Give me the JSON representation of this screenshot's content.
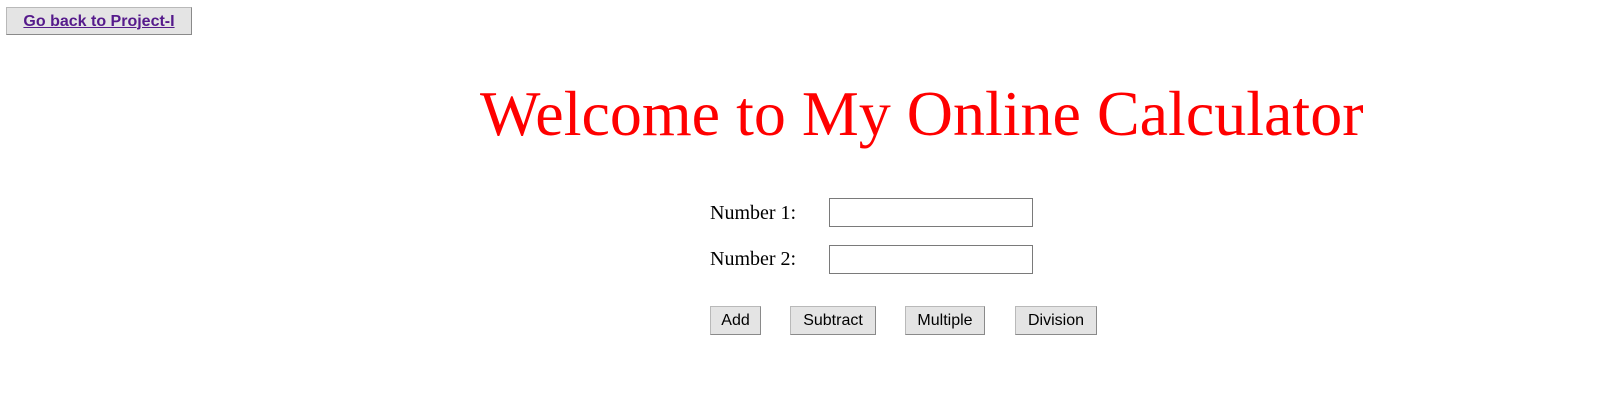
{
  "nav": {
    "back_label": "Go back to Project-I"
  },
  "header": {
    "title": "Welcome to My Online Calculator"
  },
  "form": {
    "number1_label": "Number 1:",
    "number1_value": "",
    "number2_label": "Number 2:",
    "number2_value": "",
    "buttons": {
      "add": "Add",
      "subtract": "Subtract",
      "multiple": "Multiple",
      "division": "Division"
    }
  },
  "colors": {
    "title": "#ff0000",
    "link": "#551a8b",
    "button_bg": "#e4e4e4"
  }
}
